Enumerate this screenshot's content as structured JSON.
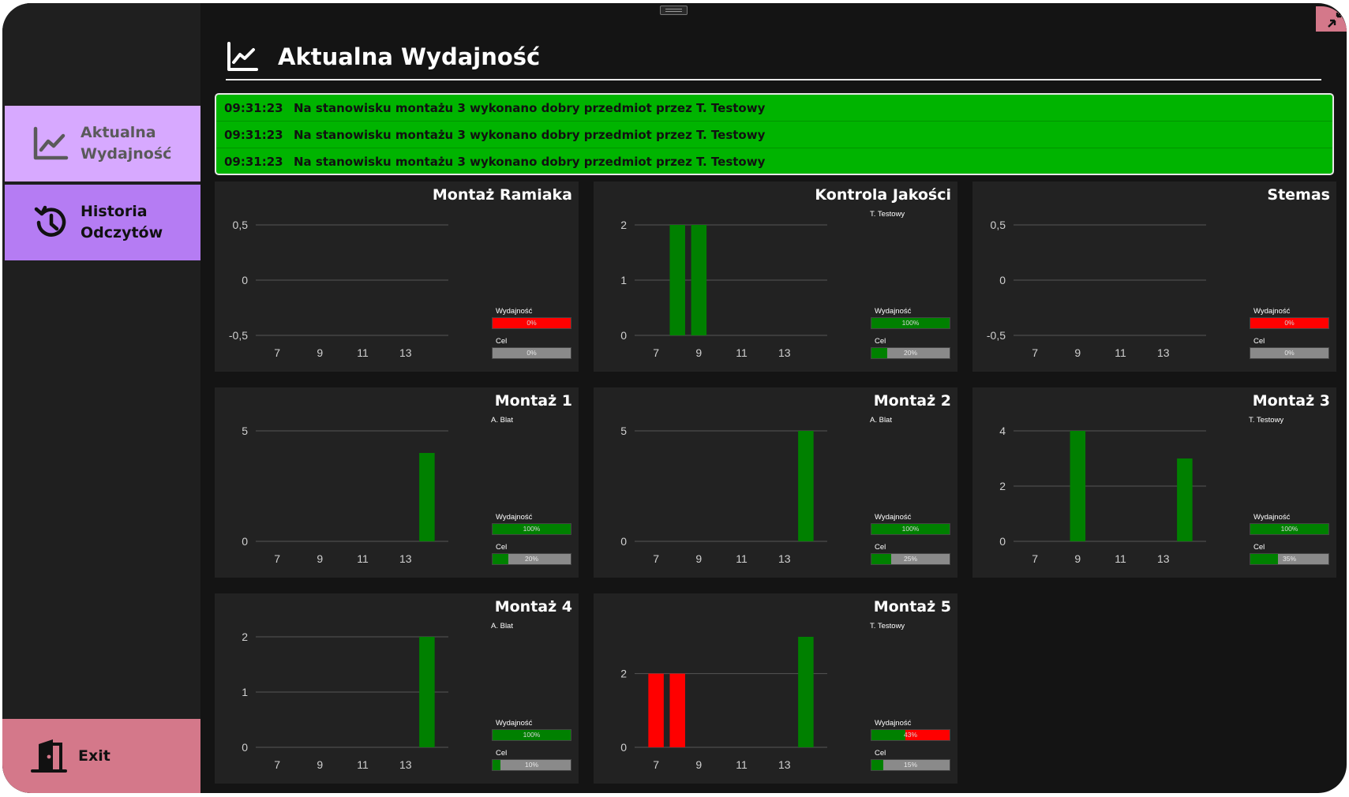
{
  "sidebar": {
    "items": [
      {
        "label": "Aktualna\nWydajność",
        "icon": "line-chart-icon"
      },
      {
        "label": "Historia\nOdczytów",
        "icon": "history-icon"
      }
    ],
    "exit_label": "Exit",
    "exit_icon": "door-exit-icon"
  },
  "header": {
    "title": "Aktualna Wydajność",
    "icon": "line-chart-icon"
  },
  "log": [
    {
      "time": "09:31:23",
      "message": "Na stanowisku montażu 3 wykonano dobry przedmiot przez T. Testowy"
    },
    {
      "time": "09:31:23",
      "message": "Na stanowisku montażu 3 wykonano dobry przedmiot przez T. Testowy"
    },
    {
      "time": "09:31:23",
      "message": "Na stanowisku montażu 3 wykonano dobry przedmiot przez T. Testowy"
    }
  ],
  "colors": {
    "good": "#008000",
    "bad": "#ff0000",
    "log_bg": "#00b400",
    "accent": "#d7a9ff",
    "exit": "#d4788a"
  },
  "labels": {
    "efficiency": "Wydajność",
    "target": "Cel"
  },
  "chart_data": [
    {
      "type": "bar",
      "title": "Montaż Ramiaka",
      "worker": "",
      "xticks": [
        "7",
        "9",
        "11",
        "13"
      ],
      "xlim": [
        6,
        15
      ],
      "yticks": [
        "0,5",
        "0",
        "-0,5"
      ],
      "ytick_values": [
        0.5,
        0,
        -0.5
      ],
      "ylim": [
        -0.5,
        0.5
      ],
      "bars": [],
      "efficiency": {
        "value": 0,
        "text": "0%",
        "status": "bad"
      },
      "target": {
        "value": 0,
        "text": "0%"
      }
    },
    {
      "type": "bar",
      "title": "Kontrola Jakości",
      "worker": "T. Testowy",
      "xticks": [
        "7",
        "9",
        "11",
        "13"
      ],
      "xlim": [
        6,
        15
      ],
      "yticks": [
        "2",
        "1",
        "0"
      ],
      "ytick_values": [
        2,
        1,
        0
      ],
      "ylim": [
        0,
        2
      ],
      "bars": [
        {
          "x": 8,
          "value": 2,
          "status": "good"
        },
        {
          "x": 9,
          "value": 2,
          "status": "good"
        }
      ],
      "efficiency": {
        "value": 100,
        "text": "100%",
        "status": "good"
      },
      "target": {
        "value": 20,
        "text": "20%"
      }
    },
    {
      "type": "bar",
      "title": "Stemas",
      "worker": "",
      "xticks": [
        "7",
        "9",
        "11",
        "13"
      ],
      "xlim": [
        6,
        15
      ],
      "yticks": [
        "0,5",
        "0",
        "-0,5"
      ],
      "ytick_values": [
        0.5,
        0,
        -0.5
      ],
      "ylim": [
        -0.5,
        0.5
      ],
      "bars": [],
      "efficiency": {
        "value": 0,
        "text": "0%",
        "status": "bad"
      },
      "target": {
        "value": 0,
        "text": "0%"
      }
    },
    {
      "type": "bar",
      "title": "Montaż 1",
      "worker": "A. Blat",
      "xticks": [
        "7",
        "9",
        "11",
        "13"
      ],
      "xlim": [
        6,
        15
      ],
      "yticks": [
        "5",
        "0"
      ],
      "ytick_values": [
        5,
        0
      ],
      "ylim": [
        0,
        5
      ],
      "bars": [
        {
          "x": 14,
          "value": 4,
          "status": "good"
        }
      ],
      "efficiency": {
        "value": 100,
        "text": "100%",
        "status": "good"
      },
      "target": {
        "value": 20,
        "text": "20%"
      }
    },
    {
      "type": "bar",
      "title": "Montaż 2",
      "worker": "A. Blat",
      "xticks": [
        "7",
        "9",
        "11",
        "13"
      ],
      "xlim": [
        6,
        15
      ],
      "yticks": [
        "5",
        "0"
      ],
      "ytick_values": [
        5,
        0
      ],
      "ylim": [
        0,
        5
      ],
      "bars": [
        {
          "x": 14,
          "value": 5,
          "status": "good"
        }
      ],
      "efficiency": {
        "value": 100,
        "text": "100%",
        "status": "good"
      },
      "target": {
        "value": 25,
        "text": "25%"
      }
    },
    {
      "type": "bar",
      "title": "Montaż 3",
      "worker": "T. Testowy",
      "xticks": [
        "7",
        "9",
        "11",
        "13"
      ],
      "xlim": [
        6,
        15
      ],
      "yticks": [
        "4",
        "2",
        "0"
      ],
      "ytick_values": [
        4,
        2,
        0
      ],
      "ylim": [
        0,
        4
      ],
      "bars": [
        {
          "x": 9,
          "value": 4,
          "status": "good"
        },
        {
          "x": 14,
          "value": 3,
          "status": "good"
        }
      ],
      "efficiency": {
        "value": 100,
        "text": "100%",
        "status": "good"
      },
      "target": {
        "value": 35,
        "text": "35%"
      }
    },
    {
      "type": "bar",
      "title": "Montaż 4",
      "worker": "A. Blat",
      "xticks": [
        "7",
        "9",
        "11",
        "13"
      ],
      "xlim": [
        6,
        15
      ],
      "yticks": [
        "2",
        "1",
        "0"
      ],
      "ytick_values": [
        2,
        1,
        0
      ],
      "ylim": [
        0,
        2
      ],
      "bars": [
        {
          "x": 14,
          "value": 2,
          "status": "good"
        }
      ],
      "efficiency": {
        "value": 100,
        "text": "100%",
        "status": "good"
      },
      "target": {
        "value": 10,
        "text": "10%"
      }
    },
    {
      "type": "bar",
      "title": "Montaż 5",
      "worker": "T. Testowy",
      "xticks": [
        "7",
        "9",
        "11",
        "13"
      ],
      "xlim": [
        6,
        15
      ],
      "yticks": [
        "2",
        "0"
      ],
      "ytick_values": [
        2,
        0
      ],
      "ylim": [
        0,
        3
      ],
      "bars": [
        {
          "x": 7,
          "value": 2,
          "status": "bad"
        },
        {
          "x": 8,
          "value": 2,
          "status": "bad"
        },
        {
          "x": 14,
          "value": 3,
          "status": "good"
        }
      ],
      "efficiency": {
        "value": 43,
        "text": "43%",
        "status": "bad"
      },
      "target": {
        "value": 15,
        "text": "15%"
      }
    }
  ]
}
